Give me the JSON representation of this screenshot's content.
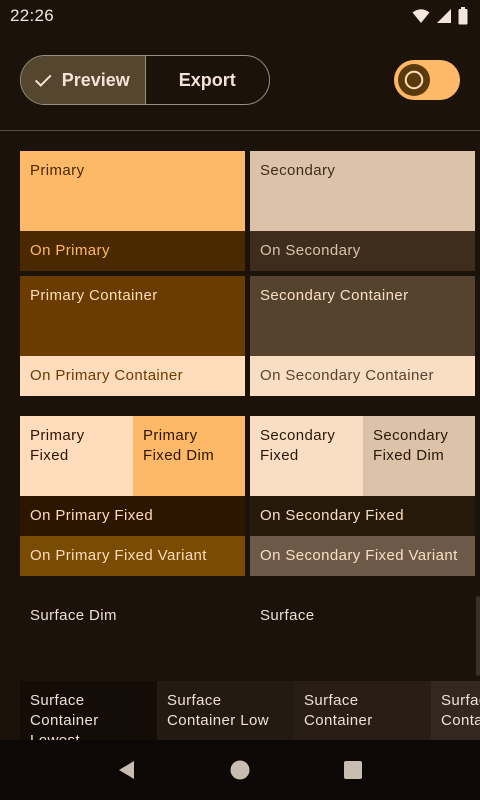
{
  "status_bar": {
    "time": "22:26"
  },
  "toolbar": {
    "preview_label": "Preview",
    "export_label": "Export"
  },
  "colors": {
    "primary": "#fdb968",
    "on_primary": "#4a2800",
    "primary_container": "#6a3c00",
    "on_primary_container": "#ffdcbc",
    "secondary": "#dcc2a9",
    "on_secondary": "#3e2d1c",
    "secondary_container": "#56432f",
    "on_secondary_container": "#fadeC4",
    "primary_fixed_variant": "#7a4b03",
    "secondary_fixed_variant": "#6c5948",
    "surface": "#1b1209"
  },
  "tiles": {
    "primary": "Primary",
    "on_primary": "On Primary",
    "secondary": "Secondary",
    "on_secondary": "On Secondary",
    "primary_container": "Primary Container",
    "on_primary_container": "On Primary Container",
    "secondary_container": "Secondary Container",
    "on_secondary_container": "On Secondary Container",
    "primary_fixed": "Primary Fixed",
    "primary_fixed_dim": "Primary Fixed Dim",
    "secondary_fixed": "Secondary Fixed",
    "secondary_fixed_dim": "Secondary Fixed Dim",
    "on_primary_fixed": "On Primary Fixed",
    "on_secondary_fixed": "On Secondary Fixed",
    "on_primary_fixed_variant": "On Primary Fixed Variant",
    "on_secondary_fixed_variant": "On Secondary Fixed Variant",
    "surface_dim": "Surface Dim",
    "surface": "Surface",
    "surface_container_lowest": "Surface Container Lowest",
    "surface_container_low": "Surface Container Low",
    "surface_container": "Surface Container",
    "surface_container_high": "Surface Container High"
  }
}
